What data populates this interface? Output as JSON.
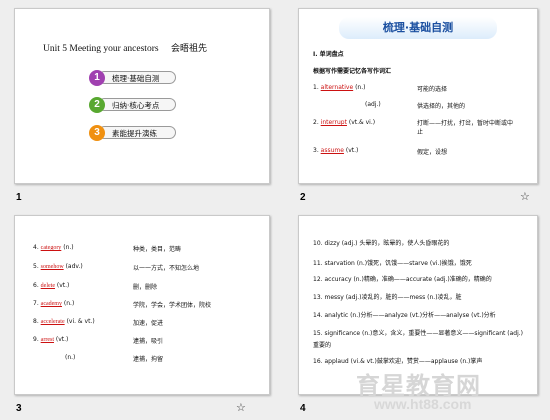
{
  "slides": [
    {
      "number": "1",
      "title_en": "Unit 5    Meeting your ancestors",
      "title_cn": "会晤祖先",
      "menu": [
        {
          "badge": "1",
          "label": "梳理·基础自测",
          "color": "#a040b0"
        },
        {
          "badge": "2",
          "label": "归纳·核心考点",
          "color": "#58a830"
        },
        {
          "badge": "3",
          "label": "素能提升演练",
          "color": "#f09010"
        }
      ]
    },
    {
      "number": "2",
      "banner": "梳理·基础自测",
      "section": "Ⅰ. 单词盘点",
      "subsection": "根据写作需要记忆各写作词汇",
      "entries": [
        {
          "num": "1.",
          "word": "alternative",
          "pos": "(n.)",
          "meaning": "可能的选择"
        },
        {
          "num": "",
          "word": "",
          "pos": "(adj.)",
          "meaning": "供选择的，其他的"
        },
        {
          "num": "2.",
          "word": "interrupt",
          "pos": "(vt.& vi.)",
          "meaning": "打断——打扰，打岔，暂时中断或中止"
        },
        {
          "num": "3.",
          "word": "assume",
          "pos": "(vt.)",
          "meaning": "假定，设想"
        }
      ]
    },
    {
      "number": "3",
      "entries": [
        {
          "num": "4.",
          "word": "category",
          "pos": "(n.)",
          "meaning": "种类，类目，范畴"
        },
        {
          "num": "5.",
          "word": "somehow",
          "pos": "(adv.)",
          "meaning": "以一一方式，不知怎么地"
        },
        {
          "num": "6.",
          "word": "delete",
          "pos": "(vt.)",
          "meaning": "删，删除"
        },
        {
          "num": "7.",
          "word": "academy",
          "pos": "(n.)",
          "meaning": "学院，学会，学术团体，院校"
        },
        {
          "num": "8.",
          "word": "accelerate",
          "pos": "(vi. & vt.)",
          "meaning": "加速，促进"
        },
        {
          "num": "9.",
          "word": "arrest",
          "pos": "(vt.)",
          "meaning": "逮捕，吸引"
        },
        {
          "num": "",
          "word": "",
          "pos": "(n.)",
          "meaning": "逮捕，拘留"
        }
      ]
    },
    {
      "number": "4",
      "entries": [
        {
          "num": "10.",
          "text": "dizzy (adj.)     头晕的，眩晕的，使人头昏眼花的"
        },
        {
          "num": "11.",
          "text": "starvation (n.)饿死，饥饿——starve (vi.)挨饿，饿死"
        },
        {
          "num": "12.",
          "text": "accuracy (n.)精确，准确——accurate (adj.)准确的，精确的"
        },
        {
          "num": "13.",
          "text": "messy (adj.)凌乱的，脏的——mess (n.)凌乱，脏"
        },
        {
          "num": "14.",
          "text": "analytic (n.)分析——analyze (vt.)分析——analyse (vt.)分析"
        },
        {
          "num": "15.",
          "text": "significance (n.)意义，含义，重要性——显著意义——significant (adj.)重要的"
        },
        {
          "num": "16.",
          "text": "applaud (vi.& vt.)鼓掌欢迎，赞赏——applause (n.)掌声"
        }
      ]
    }
  ],
  "watermark": {
    "cn": "育星教育网",
    "url": "www.ht88.com"
  },
  "transition_icon": "transition-icon"
}
